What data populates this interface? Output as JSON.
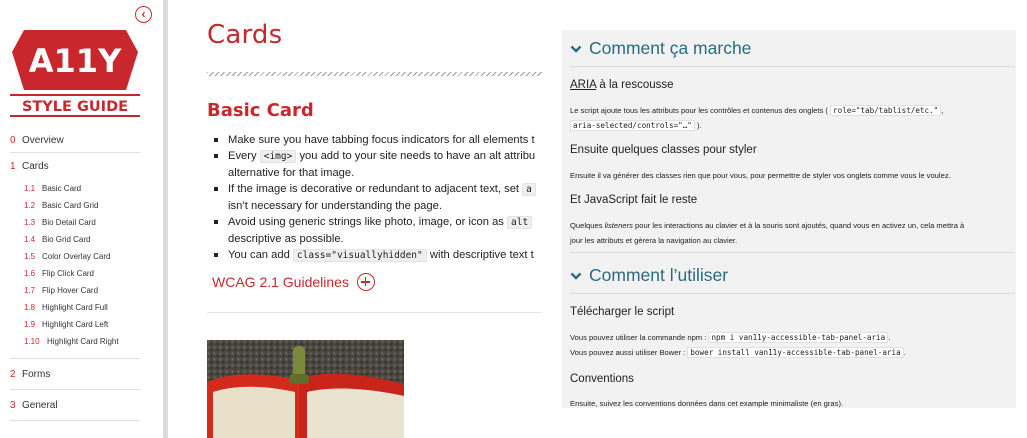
{
  "sidebar": {
    "logo_top": "A11Y",
    "logo_bottom": "STYLE GUIDE",
    "nav": {
      "overview": {
        "num": "0",
        "label": "Overview"
      },
      "cards": {
        "num": "1",
        "label": "Cards"
      },
      "card_items": [
        {
          "num": "1.1",
          "label": "Basic Card"
        },
        {
          "num": "1.2",
          "label": "Basic Card Grid"
        },
        {
          "num": "1.3",
          "label": "Bio Detail Card"
        },
        {
          "num": "1.4",
          "label": "Bio Grid Card"
        },
        {
          "num": "1.5",
          "label": "Color Overlay Card"
        },
        {
          "num": "1.6",
          "label": "Flip Click Card"
        },
        {
          "num": "1.7",
          "label": "Flip Hover Card"
        },
        {
          "num": "1.8",
          "label": "Highlight Card Full"
        },
        {
          "num": "1.9",
          "label": "Highlight Card Left"
        },
        {
          "num": "1.10",
          "label": "Highlight Card Right"
        }
      ],
      "forms": {
        "num": "2",
        "label": "Forms"
      },
      "general": {
        "num": "3",
        "label": "General"
      }
    },
    "collapse_icon": "chevron-left-circle-icon"
  },
  "main": {
    "page_title": "Cards",
    "section_title": "Basic Card",
    "bullets": {
      "b1": "Make sure you have tabbing focus indicators for all elements t",
      "b2_pre": "Every",
      "b2_code": "<img>",
      "b2_post": "you add to your site needs to have an alt attribu",
      "b2_cont": "alternative for that image.",
      "b3_pre": "If the image is decorative or redundant to adjacent text, set",
      "b3_code": "a",
      "b3_cont": "isn’t necessary for understanding the page.",
      "b4_pre": "Avoid using generic strings like photo, image, or icon as",
      "b4_code": "alt",
      "b4_cont": "descriptive as possible.",
      "b5_pre": "You can add",
      "b5_code": "class=\"visuallyhidden\"",
      "b5_post": "with descriptive text t"
    },
    "wcag_link": "WCAG 2.1 Guidelines",
    "image_alt_icon": "red-pepper-photo"
  },
  "panel": {
    "h2_how": "Comment ça marche",
    "aria_link": "ARIA",
    "aria_rest": " à la rescousse",
    "p1_pre": "Le script ajoute tous les attributs pour les contrôles et contenus des onglets (",
    "p1_code1": "role=\"tab/tablist/etc.\"",
    "p1_mid": ",",
    "p1_code2": "aria-selected/controls=\"…\"",
    "p1_post": ").",
    "h3_classes": "Ensuite quelques classes pour styler",
    "p2": "Ensuite il va générer des classes rien que pour vous, pour permettre de styler vos onglets comme vous le voulez.",
    "h3_js": "Et JavaScript fait le reste",
    "p3_pre": "Quelques ",
    "p3_em": "listeners",
    "p3_post": " pour les interactions au clavier et à la souris sont ajoutés, quand vous en activez un, cela mettra à",
    "p3_line2": "jour les attributs et gèrera la navigation au clavier.",
    "h2_use": "Comment l’utiliser",
    "h3_download": "Télécharger le script",
    "npm_pre": "Vous pouvez utiliser la commande npm :",
    "npm_code": "npm i van11y-accessible-tab-panel-aria",
    "bower_pre": "Vous pouvez aussi utiliser Bower :",
    "bower_code": "bower install van11y-accessible-tab-panel-aria",
    "h3_conventions": "Conventions",
    "p_conventions": "Ensuite, suivez les conventions données dans cet example minimaliste (en gras).",
    "accent": "#2a6b80"
  },
  "colors": {
    "brand_red": "#c8282d",
    "panel_bg": "#f2f2f2"
  }
}
